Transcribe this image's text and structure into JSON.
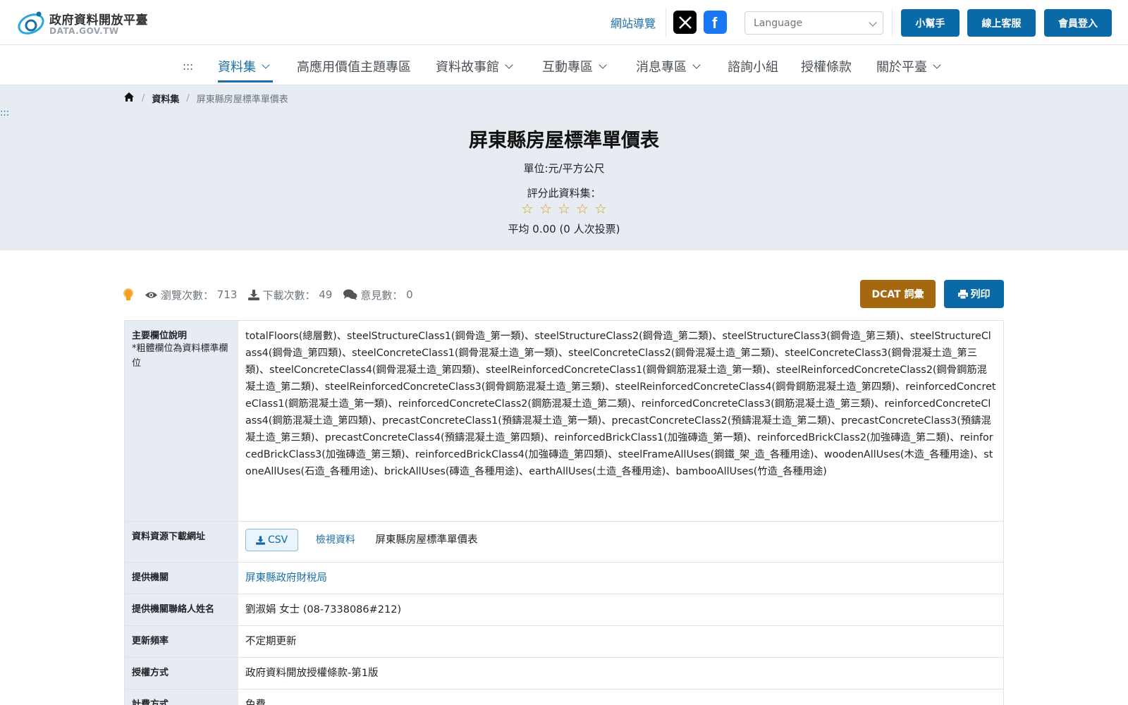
{
  "header": {
    "logo_zh": "政府資料開放平臺",
    "logo_en": "DATA.GOV.TW",
    "sitemap": "網站導覽",
    "language_placeholder": "Language",
    "buttons": [
      "小幫手",
      "線上客服",
      "會員登入"
    ]
  },
  "nav": {
    "accesskey": ":::",
    "items": [
      {
        "label": "資料集",
        "dropdown": true,
        "active": true
      },
      {
        "label": "高應用價值主題專區",
        "dropdown": false
      },
      {
        "label": "資料故事館",
        "dropdown": true
      },
      {
        "label": "互動專區",
        "dropdown": true
      },
      {
        "label": "消息專區",
        "dropdown": true
      },
      {
        "label": "諮詢小組",
        "dropdown": false
      },
      {
        "label": "授權條款",
        "dropdown": false
      },
      {
        "label": "關於平臺",
        "dropdown": true
      }
    ]
  },
  "breadcrumb": {
    "level1": "資料集",
    "current": "屏東縣房屋標準單價表"
  },
  "side_accesskey": ":::",
  "dataset": {
    "title": "屏東縣房屋標準單價表",
    "unit": "單位:元/平方公尺",
    "rate_label": "評分此資料集：",
    "stars": 5,
    "rating_avg": "平均 0.00 (0 人次投票)"
  },
  "stats": {
    "views_label": "瀏覽次數：",
    "views": "713",
    "downloads_label": "下載次數：",
    "downloads": "49",
    "comments_label": "意見數：",
    "comments": "0"
  },
  "actions": {
    "dcat": "DCAT 詞彙",
    "print": "列印"
  },
  "table": {
    "fields_label": "主要欄位說明",
    "fields_note": "*粗體欄位為資料標準欄位",
    "fields_value": "totalFloors(總層數)、steelStructureClass1(鋼骨造_第一類)、steelStructureClass2(鋼骨造_第二類)、steelStructureClass3(鋼骨造_第三類)、steelStructureClass4(鋼骨造_第四類)、steelConcreteClass1(鋼骨混凝土造_第一類)、steelConcreteClass2(鋼骨混凝土造_第二類)、steelConcreteClass3(鋼骨混凝土造_第三類)、steelConcreteClass4(鋼骨混凝土造_第四類)、steelReinforcedConcreteClass1(鋼骨鋼筋混凝土造_第一類)、steelReinforcedConcreteClass2(鋼骨鋼筋混凝土造_第二類)、steelReinforcedConcreteClass3(鋼骨鋼筋混凝土造_第三類)、steelReinforcedConcreteClass4(鋼骨鋼筋混凝土造_第四類)、reinforcedConcreteClass1(鋼筋混凝土造_第一類)、reinforcedConcreteClass2(鋼筋混凝土造_第二類)、reinforcedConcreteClass3(鋼筋混凝土造_第三類)、reinforcedConcreteClass4(鋼筋混凝土造_第四類)、precastConcreteClass1(預鑄混凝土造_第一類)、precastConcreteClass2(預鑄混凝土造_第二類)、precastConcreteClass3(預鑄混凝土造_第三類)、precastConcreteClass4(預鑄混凝土造_第四類)、reinforcedBrickClass1(加強磚造_第一類)、reinforcedBrickClass2(加強磚造_第二類)、reinforcedBrickClass3(加強磚造_第三類)、reinforcedBrickClass4(加強磚造_第四類)、steelFrameAllUses(鋼鐵_架_造_各種用途)、woodenAllUses(木造_各種用途)、stoneAllUses(石造_各種用途)、brickAllUses(磚造_各種用途)、earthAllUses(土造_各種用途)、bambooAllUses(竹造_各種用途)",
    "download_label": "資料資源下載網址",
    "csv_label": "CSV",
    "view_label": "檢視資料",
    "resource_name": "屏東縣房屋標準單價表",
    "provider_label": "提供機關",
    "provider_value": "屏東縣政府財稅局",
    "contact_label": "提供機關聯絡人姓名",
    "contact_value": "劉淑娟 女士 (08-7338086#212)",
    "frequency_label": "更新頻率",
    "frequency_value": "不定期更新",
    "license_label": "授權方式",
    "license_value": "政府資料開放授權條款-第1版",
    "fee_label": "計費方式",
    "fee_value": "免費"
  },
  "colors": {
    "primary": "#0a6aa8",
    "link": "#1b6fa6",
    "dcat": "#a5680f",
    "hero_bg": "#e6ecf1",
    "star": "#d9a21b"
  }
}
